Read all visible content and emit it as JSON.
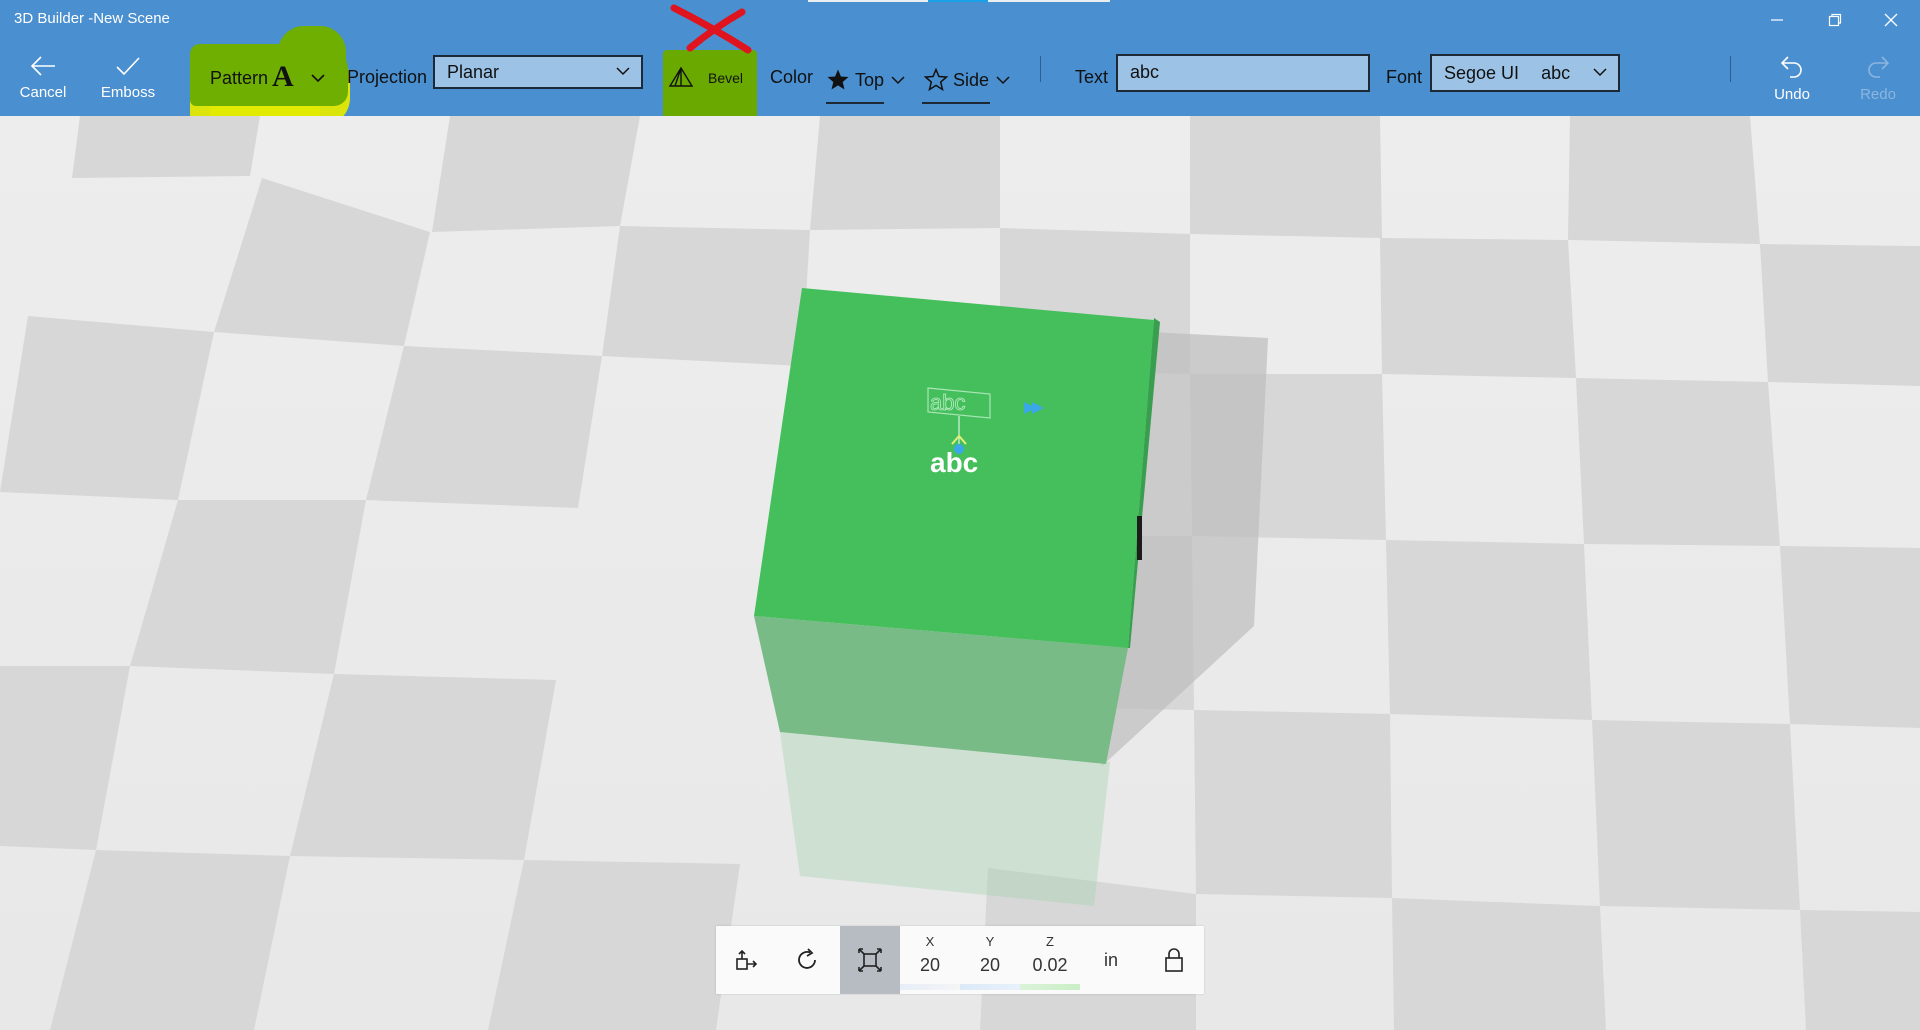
{
  "window": {
    "title": "3D Builder -New Scene"
  },
  "toolbar": {
    "cancel_label": "Cancel",
    "emboss_label": "Emboss",
    "pattern_label": "Pattern",
    "pattern_glyph": "A",
    "projection_label": "Projection",
    "projection_value": "Planar",
    "bevel_label": "Bevel",
    "color_label": "Color",
    "top_label": "Top",
    "side_label": "Side",
    "text_label": "Text",
    "text_value": "abc",
    "font_label": "Font",
    "font_value": "Segoe UI",
    "font_preview": "abc",
    "undo_label": "Undo",
    "redo_label": "Redo"
  },
  "scene": {
    "emboss_text": "abc",
    "ghost_text": "abc",
    "cube_color": "#44bf5c"
  },
  "transform": {
    "x_axis": "X",
    "y_axis": "Y",
    "z_axis": "Z",
    "x_value": "20",
    "y_value": "20",
    "z_value": "0.02",
    "unit": "in"
  },
  "colors": {
    "toolbar_bg": "#4a8fcf",
    "highlight_yellow": "#e3ea00",
    "highlight_green": "#6aaa00",
    "annotation_red": "#e0141f"
  },
  "icons": [
    "back-arrow-icon",
    "checkmark-icon",
    "chevron-down-icon",
    "bevel-icon",
    "star-filled-icon",
    "star-outline-icon",
    "undo-icon",
    "redo-icon",
    "minimize-icon",
    "maximize-icon",
    "close-icon",
    "move-icon",
    "rotate-icon",
    "scale-icon",
    "lock-icon"
  ]
}
